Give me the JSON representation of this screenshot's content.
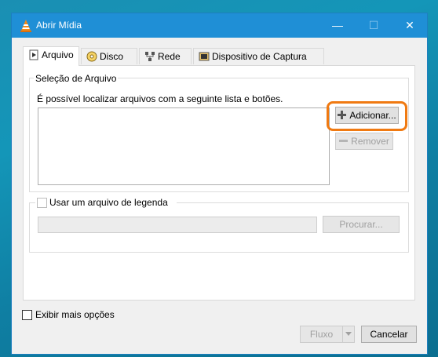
{
  "window": {
    "title": "Abrir Mídia",
    "minimize_glyph": "—",
    "maximize_glyph": "☐",
    "close_glyph": "✕"
  },
  "tabs": [
    {
      "label": "Arquivo",
      "icon": "file-play-icon",
      "active": true
    },
    {
      "label": "Disco",
      "icon": "disc-icon",
      "active": false
    },
    {
      "label": "Rede",
      "icon": "network-icon",
      "active": false
    },
    {
      "label": "Dispositivo de Captura",
      "icon": "capture-device-icon",
      "active": false
    }
  ],
  "file_selection": {
    "group_title": "Seleção de Arquivo",
    "description": "É possível localizar arquivos com a seguinte lista e botões.",
    "add_button": "Adicionar...",
    "remove_button": "Remover"
  },
  "subtitle": {
    "checkbox_label": "Usar um arquivo de legenda",
    "browse_button": "Procurar..."
  },
  "more_options_label": "Exibir mais opções",
  "footer": {
    "stream_button": "Fluxo",
    "cancel_button": "Cancelar"
  },
  "colors": {
    "titlebar": "#1f8fd6",
    "highlight": "#f07a12"
  }
}
